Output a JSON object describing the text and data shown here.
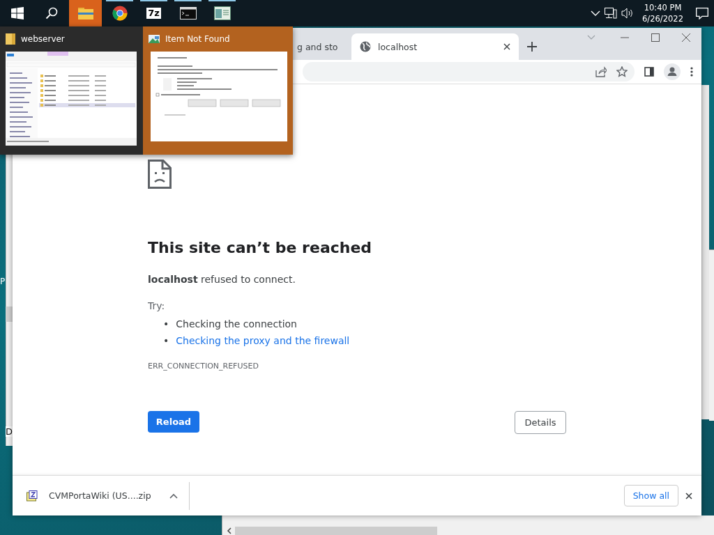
{
  "taskbar": {
    "apps": [
      {
        "kind": "start",
        "selected": false,
        "running": false
      },
      {
        "kind": "search",
        "selected": false,
        "running": false
      },
      {
        "kind": "explorer",
        "selected": true,
        "running": false
      },
      {
        "kind": "chrome",
        "selected": false,
        "running": true
      },
      {
        "kind": "archiver",
        "label": "7z",
        "selected": false,
        "running": true
      },
      {
        "kind": "console",
        "selected": false,
        "running": true
      },
      {
        "kind": "window",
        "selected": false,
        "running": true
      }
    ],
    "clock": {
      "time": "10:40 PM",
      "date": "6/26/2022"
    }
  },
  "background_windows": {
    "left_letters": [
      "P",
      "D"
    ]
  },
  "browser": {
    "tabs": [
      {
        "title": "g and sto",
        "selected": false
      },
      {
        "title": "localhost",
        "selected": true
      }
    ],
    "error_page": {
      "title": "This site can’t be reached",
      "message": "**localhost** refused to connect.",
      "try_label": "Try:",
      "suggestions": [
        {
          "bullet": "•",
          "text": "Checking the connection",
          "kind": "text"
        },
        {
          "bullet": "•",
          "text": "Checking the proxy and the firewall",
          "kind": "link"
        }
      ],
      "error_code": "ERR_CONNECTION_REFUSED",
      "primary_button": "Reload",
      "secondary_button": "Details"
    },
    "download_bar": {
      "file": "CVMPortaWiki (US....zip",
      "show_all": "Show all"
    }
  },
  "preview": {
    "windows": [
      {
        "kind": "explorer",
        "title": "webserver",
        "selected": false
      },
      {
        "kind": "dialog",
        "title": "Item Not Found",
        "selected": true
      }
    ]
  }
}
